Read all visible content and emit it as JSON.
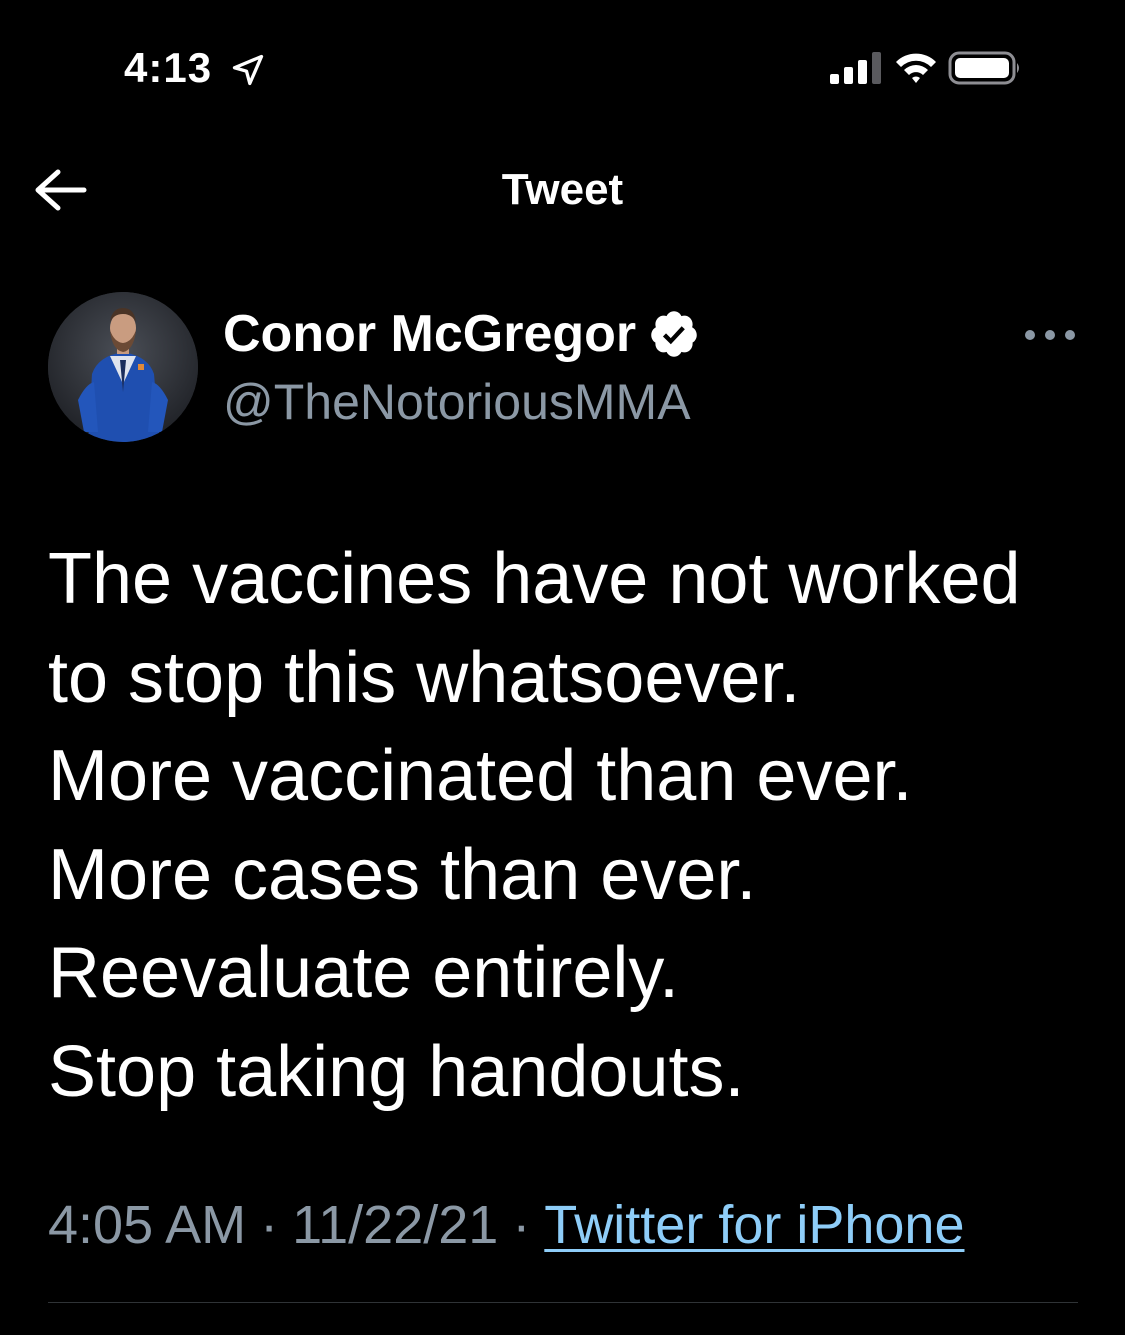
{
  "status_bar": {
    "time": "4:13",
    "icons": [
      "location-arrow-icon",
      "cellular-signal-icon",
      "wifi-icon",
      "battery-icon"
    ]
  },
  "header": {
    "title": "Tweet",
    "back_icon": "arrow-left-icon"
  },
  "tweet": {
    "author": {
      "display_name": "Conor McGregor",
      "handle": "@TheNotoriousMMA",
      "verified": true
    },
    "lines": [
      "The vaccines have not worked",
      "to stop this whatsoever.",
      "More vaccinated than ever.",
      "More cases than ever.",
      "Reevaluate entirely.",
      "Stop taking handouts."
    ],
    "time": "4:05 AM",
    "date": "11/22/21",
    "separator": "·",
    "source": "Twitter for iPhone"
  },
  "colors": {
    "background": "#000000",
    "text": "#ffffff",
    "secondary_text": "#8b98a5",
    "link": "#8ecdf8",
    "divider": "#2f3336"
  }
}
